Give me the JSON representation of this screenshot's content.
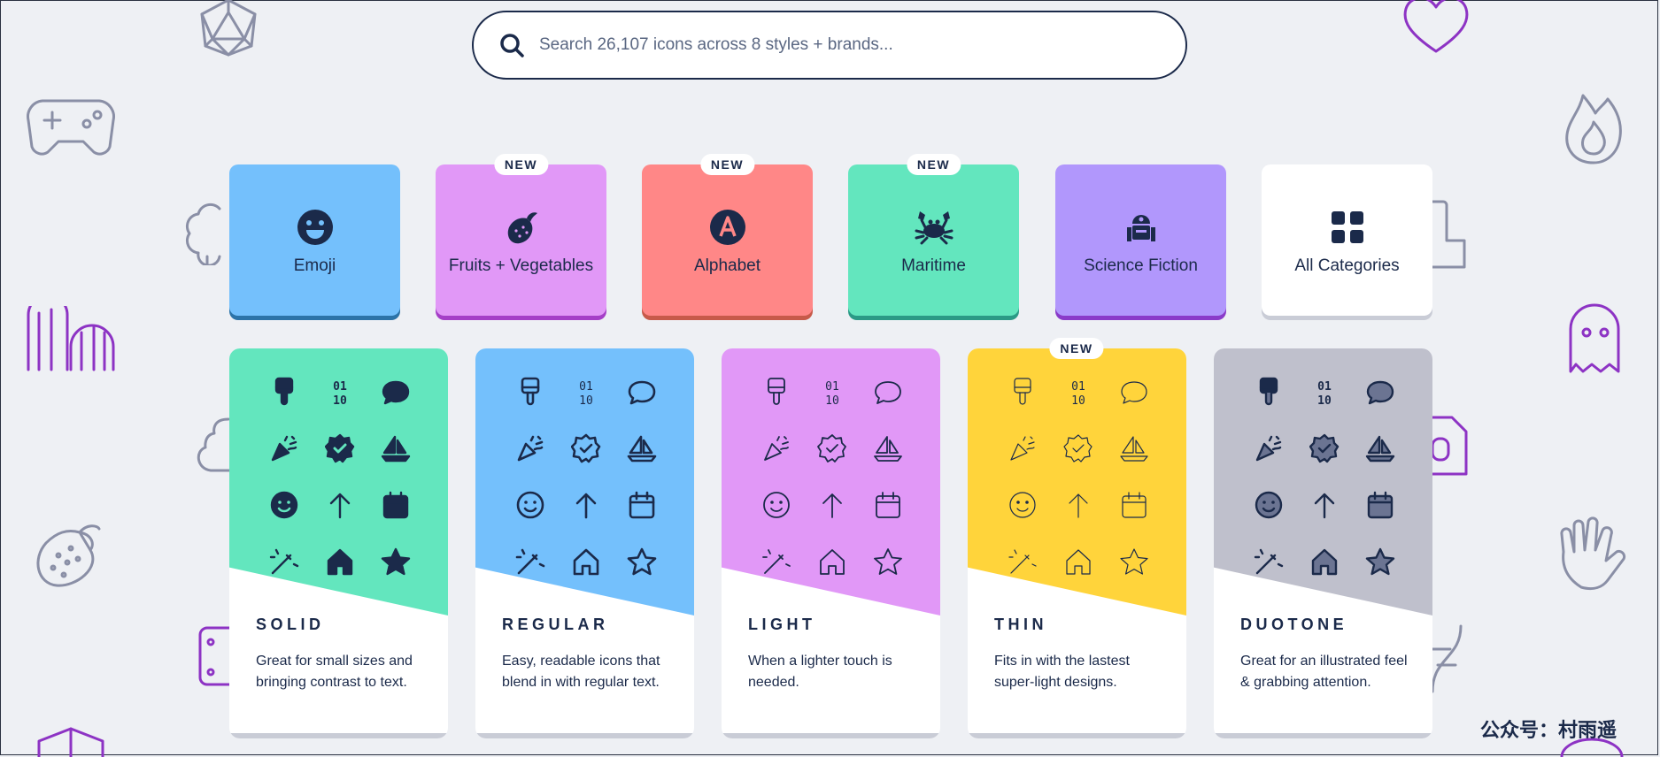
{
  "search": {
    "placeholder": "Search 26,107 icons across 8 styles + brands..."
  },
  "categories": [
    {
      "label": "Emoji",
      "badge": "",
      "color": "#74c0fc",
      "shadow": "#2c73a8"
    },
    {
      "label": "Fruits + Vegetables",
      "badge": "NEW",
      "color": "#e198f7",
      "shadow": "#a53fc7"
    },
    {
      "label": "Alphabet",
      "badge": "NEW",
      "color": "#ff8787",
      "shadow": "#c75a4a"
    },
    {
      "label": "Maritime",
      "badge": "NEW",
      "color": "#63e6be",
      "shadow": "#2b9a86"
    },
    {
      "label": "Science Fiction",
      "badge": "",
      "color": "#b197fc",
      "shadow": "#8a3bc9"
    },
    {
      "label": "All Categories",
      "badge": "",
      "color": "#ffffff",
      "shadow": "#c9ccd6"
    }
  ],
  "styles": [
    {
      "title": "SOLID",
      "desc": "Great for small sizes and bringing contrast to text.",
      "color": "#63e6be",
      "badge": ""
    },
    {
      "title": "REGULAR",
      "desc": "Easy, readable icons that blend in with regular text.",
      "color": "#74c0fc",
      "badge": ""
    },
    {
      "title": "LIGHT",
      "desc": "When a lighter touch is needed.",
      "color": "#e198f7",
      "badge": ""
    },
    {
      "title": "THIN",
      "desc": "Fits in with the lastest super-light designs.",
      "color": "#ffd43b",
      "badge": "NEW"
    },
    {
      "title": "DUOTONE",
      "desc": "Great for an illustrated feel & grabbing attention.",
      "color": "#bfc0cc",
      "badge": ""
    }
  ],
  "icon_names": [
    "paintbrush-icon",
    "binary-icon",
    "comment-icon",
    "party-popper-icon",
    "badge-check-icon",
    "sailboat-icon",
    "smile-icon",
    "arrow-up-icon",
    "calendar-icon",
    "magic-wand-icon",
    "house-icon",
    "star-icon"
  ],
  "watermark": "公众号：村雨遥"
}
